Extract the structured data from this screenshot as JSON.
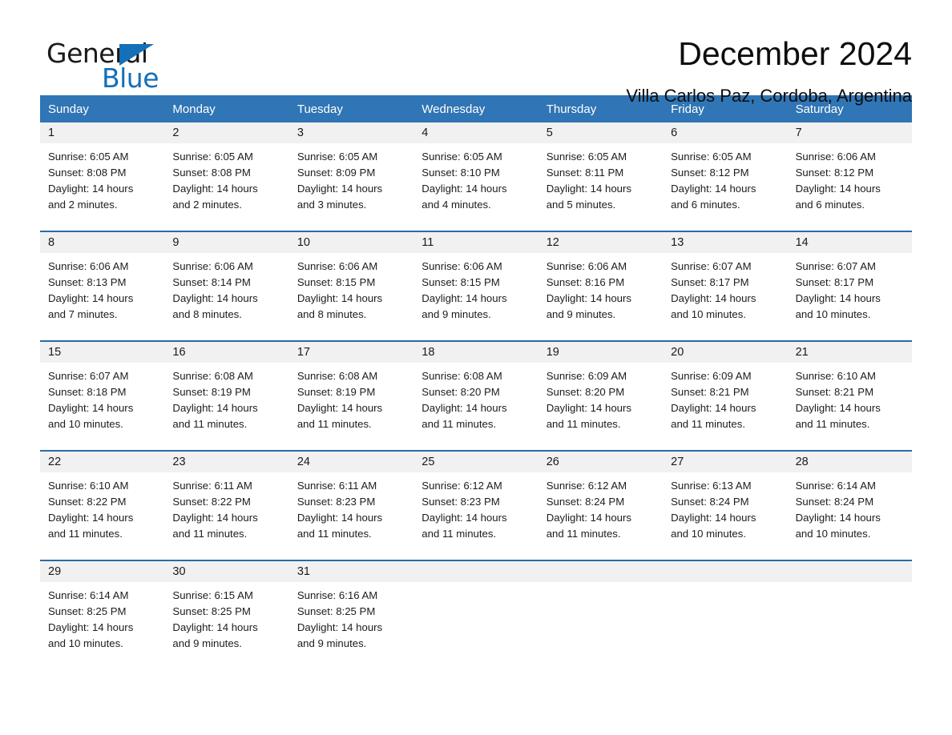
{
  "brand": {
    "name_part1": "General",
    "name_part2": "Blue",
    "triangle_color": "#1470b8"
  },
  "header": {
    "month_title": "December 2024",
    "location": "Villa Carlos Paz, Cordoba, Argentina"
  },
  "theme": {
    "header_blue": "#3075b5",
    "row_divider_blue": "#2a6ba6",
    "daynum_band": "#f1f1f1",
    "text": "#1c1c1c"
  },
  "weekdays": [
    "Sunday",
    "Monday",
    "Tuesday",
    "Wednesday",
    "Thursday",
    "Friday",
    "Saturday"
  ],
  "weeks": [
    {
      "days": [
        {
          "num": "1",
          "sunrise": "Sunrise: 6:05 AM",
          "sunset": "Sunset: 8:08 PM",
          "daylight_1": "Daylight: 14 hours",
          "daylight_2": "and 2 minutes."
        },
        {
          "num": "2",
          "sunrise": "Sunrise: 6:05 AM",
          "sunset": "Sunset: 8:08 PM",
          "daylight_1": "Daylight: 14 hours",
          "daylight_2": "and 2 minutes."
        },
        {
          "num": "3",
          "sunrise": "Sunrise: 6:05 AM",
          "sunset": "Sunset: 8:09 PM",
          "daylight_1": "Daylight: 14 hours",
          "daylight_2": "and 3 minutes."
        },
        {
          "num": "4",
          "sunrise": "Sunrise: 6:05 AM",
          "sunset": "Sunset: 8:10 PM",
          "daylight_1": "Daylight: 14 hours",
          "daylight_2": "and 4 minutes."
        },
        {
          "num": "5",
          "sunrise": "Sunrise: 6:05 AM",
          "sunset": "Sunset: 8:11 PM",
          "daylight_1": "Daylight: 14 hours",
          "daylight_2": "and 5 minutes."
        },
        {
          "num": "6",
          "sunrise": "Sunrise: 6:05 AM",
          "sunset": "Sunset: 8:12 PM",
          "daylight_1": "Daylight: 14 hours",
          "daylight_2": "and 6 minutes."
        },
        {
          "num": "7",
          "sunrise": "Sunrise: 6:06 AM",
          "sunset": "Sunset: 8:12 PM",
          "daylight_1": "Daylight: 14 hours",
          "daylight_2": "and 6 minutes."
        }
      ]
    },
    {
      "days": [
        {
          "num": "8",
          "sunrise": "Sunrise: 6:06 AM",
          "sunset": "Sunset: 8:13 PM",
          "daylight_1": "Daylight: 14 hours",
          "daylight_2": "and 7 minutes."
        },
        {
          "num": "9",
          "sunrise": "Sunrise: 6:06 AM",
          "sunset": "Sunset: 8:14 PM",
          "daylight_1": "Daylight: 14 hours",
          "daylight_2": "and 8 minutes."
        },
        {
          "num": "10",
          "sunrise": "Sunrise: 6:06 AM",
          "sunset": "Sunset: 8:15 PM",
          "daylight_1": "Daylight: 14 hours",
          "daylight_2": "and 8 minutes."
        },
        {
          "num": "11",
          "sunrise": "Sunrise: 6:06 AM",
          "sunset": "Sunset: 8:15 PM",
          "daylight_1": "Daylight: 14 hours",
          "daylight_2": "and 9 minutes."
        },
        {
          "num": "12",
          "sunrise": "Sunrise: 6:06 AM",
          "sunset": "Sunset: 8:16 PM",
          "daylight_1": "Daylight: 14 hours",
          "daylight_2": "and 9 minutes."
        },
        {
          "num": "13",
          "sunrise": "Sunrise: 6:07 AM",
          "sunset": "Sunset: 8:17 PM",
          "daylight_1": "Daylight: 14 hours",
          "daylight_2": "and 10 minutes."
        },
        {
          "num": "14",
          "sunrise": "Sunrise: 6:07 AM",
          "sunset": "Sunset: 8:17 PM",
          "daylight_1": "Daylight: 14 hours",
          "daylight_2": "and 10 minutes."
        }
      ]
    },
    {
      "days": [
        {
          "num": "15",
          "sunrise": "Sunrise: 6:07 AM",
          "sunset": "Sunset: 8:18 PM",
          "daylight_1": "Daylight: 14 hours",
          "daylight_2": "and 10 minutes."
        },
        {
          "num": "16",
          "sunrise": "Sunrise: 6:08 AM",
          "sunset": "Sunset: 8:19 PM",
          "daylight_1": "Daylight: 14 hours",
          "daylight_2": "and 11 minutes."
        },
        {
          "num": "17",
          "sunrise": "Sunrise: 6:08 AM",
          "sunset": "Sunset: 8:19 PM",
          "daylight_1": "Daylight: 14 hours",
          "daylight_2": "and 11 minutes."
        },
        {
          "num": "18",
          "sunrise": "Sunrise: 6:08 AM",
          "sunset": "Sunset: 8:20 PM",
          "daylight_1": "Daylight: 14 hours",
          "daylight_2": "and 11 minutes."
        },
        {
          "num": "19",
          "sunrise": "Sunrise: 6:09 AM",
          "sunset": "Sunset: 8:20 PM",
          "daylight_1": "Daylight: 14 hours",
          "daylight_2": "and 11 minutes."
        },
        {
          "num": "20",
          "sunrise": "Sunrise: 6:09 AM",
          "sunset": "Sunset: 8:21 PM",
          "daylight_1": "Daylight: 14 hours",
          "daylight_2": "and 11 minutes."
        },
        {
          "num": "21",
          "sunrise": "Sunrise: 6:10 AM",
          "sunset": "Sunset: 8:21 PM",
          "daylight_1": "Daylight: 14 hours",
          "daylight_2": "and 11 minutes."
        }
      ]
    },
    {
      "days": [
        {
          "num": "22",
          "sunrise": "Sunrise: 6:10 AM",
          "sunset": "Sunset: 8:22 PM",
          "daylight_1": "Daylight: 14 hours",
          "daylight_2": "and 11 minutes."
        },
        {
          "num": "23",
          "sunrise": "Sunrise: 6:11 AM",
          "sunset": "Sunset: 8:22 PM",
          "daylight_1": "Daylight: 14 hours",
          "daylight_2": "and 11 minutes."
        },
        {
          "num": "24",
          "sunrise": "Sunrise: 6:11 AM",
          "sunset": "Sunset: 8:23 PM",
          "daylight_1": "Daylight: 14 hours",
          "daylight_2": "and 11 minutes."
        },
        {
          "num": "25",
          "sunrise": "Sunrise: 6:12 AM",
          "sunset": "Sunset: 8:23 PM",
          "daylight_1": "Daylight: 14 hours",
          "daylight_2": "and 11 minutes."
        },
        {
          "num": "26",
          "sunrise": "Sunrise: 6:12 AM",
          "sunset": "Sunset: 8:24 PM",
          "daylight_1": "Daylight: 14 hours",
          "daylight_2": "and 11 minutes."
        },
        {
          "num": "27",
          "sunrise": "Sunrise: 6:13 AM",
          "sunset": "Sunset: 8:24 PM",
          "daylight_1": "Daylight: 14 hours",
          "daylight_2": "and 10 minutes."
        },
        {
          "num": "28",
          "sunrise": "Sunrise: 6:14 AM",
          "sunset": "Sunset: 8:24 PM",
          "daylight_1": "Daylight: 14 hours",
          "daylight_2": "and 10 minutes."
        }
      ]
    },
    {
      "days": [
        {
          "num": "29",
          "sunrise": "Sunrise: 6:14 AM",
          "sunset": "Sunset: 8:25 PM",
          "daylight_1": "Daylight: 14 hours",
          "daylight_2": "and 10 minutes."
        },
        {
          "num": "30",
          "sunrise": "Sunrise: 6:15 AM",
          "sunset": "Sunset: 8:25 PM",
          "daylight_1": "Daylight: 14 hours",
          "daylight_2": "and 9 minutes."
        },
        {
          "num": "31",
          "sunrise": "Sunrise: 6:16 AM",
          "sunset": "Sunset: 8:25 PM",
          "daylight_1": "Daylight: 14 hours",
          "daylight_2": "and 9 minutes."
        },
        {
          "num": "",
          "sunrise": "",
          "sunset": "",
          "daylight_1": "",
          "daylight_2": ""
        },
        {
          "num": "",
          "sunrise": "",
          "sunset": "",
          "daylight_1": "",
          "daylight_2": ""
        },
        {
          "num": "",
          "sunrise": "",
          "sunset": "",
          "daylight_1": "",
          "daylight_2": ""
        },
        {
          "num": "",
          "sunrise": "",
          "sunset": "",
          "daylight_1": "",
          "daylight_2": ""
        }
      ]
    }
  ]
}
